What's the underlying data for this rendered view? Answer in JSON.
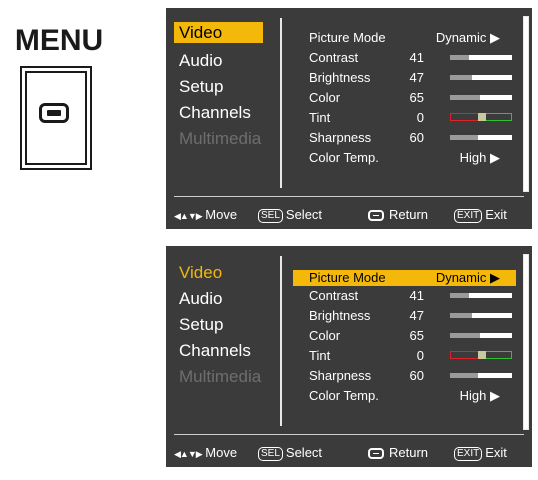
{
  "menu_label": "MENU",
  "remote_button_icon": "menu-button-icon",
  "categories": [
    {
      "label": "Video",
      "state": "active"
    },
    {
      "label": "Audio",
      "state": "normal"
    },
    {
      "label": "Setup",
      "state": "normal"
    },
    {
      "label": "Channels",
      "state": "normal"
    },
    {
      "label": "Multimedia",
      "state": "disabled"
    }
  ],
  "settings": [
    {
      "label": "Picture Mode",
      "value": "Dynamic ▶"
    },
    {
      "label": "Contrast",
      "value": "41",
      "level": 41
    },
    {
      "label": "Brightness",
      "value": "47",
      "level": 47
    },
    {
      "label": "Color",
      "value": "65",
      "level": 65
    },
    {
      "label": "Tint",
      "value": "0",
      "level": 0
    },
    {
      "label": "Sharpness",
      "value": "60",
      "level": 60
    },
    {
      "label": "Color Temp.",
      "value": "High ▶"
    }
  ],
  "footer": {
    "move_label": "Move",
    "select_key": "SEL",
    "select_label": "Select",
    "return_label": "Return",
    "exit_key": "EXIT",
    "exit_label": "Exit",
    "move_icon": "◀▲▼▶"
  },
  "colors": {
    "highlight": "#f4b80a",
    "panel_bg": "#3b3b3b",
    "tint_red": "#e0202a",
    "tint_green": "#2fc12f"
  }
}
